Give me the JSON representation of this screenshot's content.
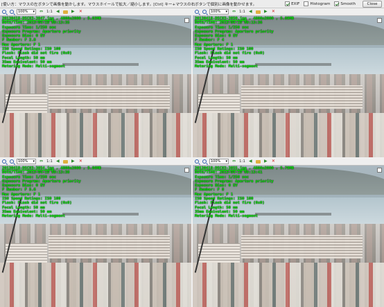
{
  "topbar": {
    "hint": "[使い方：マウスの左ボタンで画像を動かします。マウスホイールで拡大／縮小します。[Ctrl] キー+マウスの右ボタンで個別に画像を動かせます。",
    "exif": {
      "label": "EXIF",
      "checked": true
    },
    "histogram": {
      "label": "Histogram",
      "checked": false
    },
    "smooth": {
      "label": "Smooth",
      "checked": true
    },
    "close_label": "Close"
  },
  "toolbar": {
    "zoom_value": "100%",
    "ratio_label": "1:1"
  },
  "panels": [
    {
      "filename": "20130418-DSC03-3847.jpg",
      "dims": "4800x2000",
      "size": "5.83MB",
      "datetime": "Date/Time: 2013-04-19 09:13:35",
      "exposure_time": "Exposure Time: 1/250 sec",
      "exposure_program": "Exposure Program: Aperture priority",
      "exposure_bias": "Exposure Bias: 0 EV",
      "fnumber": "F Number: F 2.8",
      "max_aperture": "Max Aperture: F 1",
      "iso": "ISO Speed Ratings: ISO 100",
      "flash": "Flash: Flash did not fire (0x0)",
      "focal": "Focal Length: 50 mm",
      "focal35": "35mm Equivalent: 50 mm",
      "metering": "Metering Mode: Multi-segment"
    },
    {
      "filename": "20130418-DSC03-3850.jpg",
      "dims": "4800x2000",
      "size": "5.89MB",
      "datetime": "Date/Time: 2013-04-19 09:13:36",
      "exposure_time": "Exposure Time: 1/250 sec",
      "exposure_program": "Exposure Program: Aperture priority",
      "exposure_bias": "Exposure Bias: 0 EV",
      "fnumber": "F Number: F 4",
      "max_aperture": "Max Aperture: F 1",
      "iso": "ISO Speed Ratings: ISO 100",
      "flash": "Flash: Flash did not fire (0x0)",
      "focal": "Focal Length: 50 mm",
      "focal35": "35mm Equivalent: 50 mm",
      "metering": "Metering Mode: Multi-segment"
    },
    {
      "filename": "20130418-DSC03-3854.jpg",
      "dims": "4800x2000",
      "size": "5.86MB",
      "datetime": "Date/Time: 2013-04-19 09:13:38",
      "exposure_time": "Exposure Time: 1/250 sec",
      "exposure_program": "Exposure Program: Aperture priority",
      "exposure_bias": "Exposure Bias: 0 EV",
      "fnumber": "F Number: F 5.6",
      "max_aperture": "Max Aperture: F 1",
      "iso": "ISO Speed Ratings: ISO 100",
      "flash": "Flash: Flash did not fire (0x0)",
      "focal": "Focal Length: 50 mm",
      "focal35": "35mm Equivalent: 50 mm",
      "metering": "Metering Mode: Multi-segment"
    },
    {
      "filename": "20130418-DSC03-3855.jpg",
      "dims": "4800x2000",
      "size": "5.79MB",
      "datetime": "Date/Time: 2013-04-19 09:13:41",
      "exposure_time": "Exposure Time: 1/250 sec",
      "exposure_program": "Exposure Program: Aperture priority",
      "exposure_bias": "Exposure Bias: 0 EV",
      "fnumber": "F Number: F 8",
      "max_aperture": "Max Aperture: F 1",
      "iso": "ISO Speed Ratings: ISO 100",
      "flash": "Flash: Flash did not fire (0x0)",
      "focal": "Focal Length: 50 mm",
      "focal35": "35mm Equivalent: 50 mm",
      "metering": "Metering Mode: Multi-segment"
    }
  ],
  "icons": {
    "zoom_in": "zoom-in-icon",
    "zoom_out": "zoom-out-icon",
    "prev": "arrow-left-icon",
    "next": "arrow-right-icon",
    "folder": "folder-icon",
    "close": "close-icon"
  }
}
